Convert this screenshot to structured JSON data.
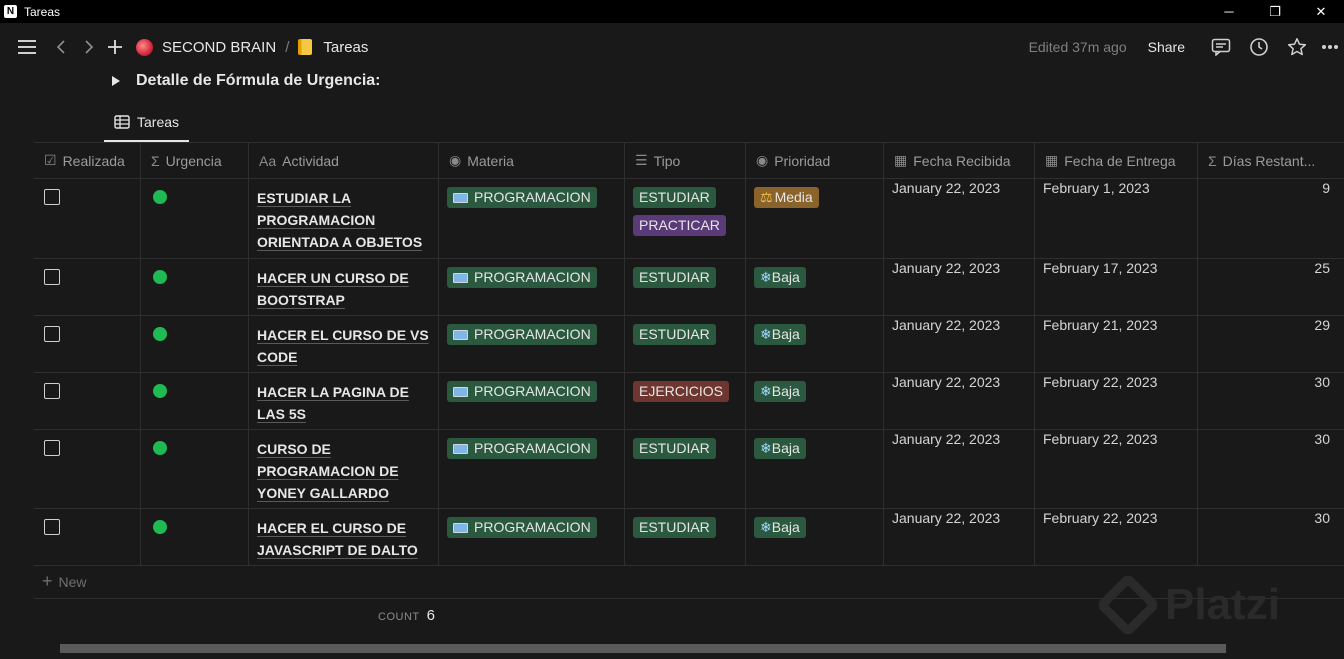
{
  "window": {
    "title": "Tareas",
    "app_icon": "N"
  },
  "breadcrumb": {
    "workspace": "SECOND BRAIN",
    "separator": "/",
    "page": "Tareas"
  },
  "header": {
    "edited": "Edited 37m ago",
    "share": "Share"
  },
  "toggle": {
    "label": "Detalle de Fórmula de Urgencia:"
  },
  "view_tab": {
    "label": "Tareas"
  },
  "columns": [
    {
      "icon": "☑",
      "label": "Realizada"
    },
    {
      "icon": "Σ",
      "label": "Urgencia"
    },
    {
      "icon": "Aa",
      "label": "Actividad"
    },
    {
      "icon": "◉",
      "label": "Materia"
    },
    {
      "icon": "☰",
      "label": "Tipo"
    },
    {
      "icon": "◉",
      "label": "Prioridad"
    },
    {
      "icon": "▦",
      "label": "Fecha Recibida"
    },
    {
      "icon": "▦",
      "label": "Fecha de Entrega"
    },
    {
      "icon": "Σ",
      "label": "Días Restant..."
    }
  ],
  "rows": [
    {
      "activity": "ESTUDIAR LA PROGRAMACION ORIENTADA A OBJETOS",
      "materia": "PROGRAMACION",
      "tipo": [
        "ESTUDIAR",
        "PRACTICAR"
      ],
      "prioridad": "Media",
      "recibida": "January 22, 2023",
      "entrega": "February 1, 2023",
      "dias": "9"
    },
    {
      "activity": "HACER UN CURSO DE BOOTSTRAP",
      "materia": "PROGRAMACION",
      "tipo": [
        "ESTUDIAR"
      ],
      "prioridad": "Baja",
      "recibida": "January 22, 2023",
      "entrega": "February 17, 2023",
      "dias": "25"
    },
    {
      "activity": "HACER EL CURSO DE VS CODE",
      "materia": "PROGRAMACION",
      "tipo": [
        "ESTUDIAR"
      ],
      "prioridad": "Baja",
      "recibida": "January 22, 2023",
      "entrega": "February 21, 2023",
      "dias": "29"
    },
    {
      "activity": "HACER LA PAGINA DE LAS 5S",
      "materia": "PROGRAMACION",
      "tipo": [
        "EJERCICIOS"
      ],
      "prioridad": "Baja",
      "recibida": "January 22, 2023",
      "entrega": "February 22, 2023",
      "dias": "30"
    },
    {
      "activity": "CURSO DE PROGRAMACION DE YONEY GALLARDO",
      "materia": "PROGRAMACION",
      "tipo": [
        "ESTUDIAR"
      ],
      "prioridad": "Baja",
      "recibida": "January 22, 2023",
      "entrega": "February 22, 2023",
      "dias": "30"
    },
    {
      "activity": "HACER EL CURSO DE JAVASCRIPT DE DALTO",
      "materia": "PROGRAMACION",
      "tipo": [
        "ESTUDIAR"
      ],
      "prioridad": "Baja",
      "recibida": "January 22, 2023",
      "entrega": "February 22, 2023",
      "dias": "30"
    }
  ],
  "new_row": {
    "label": "New"
  },
  "footer": {
    "count_label": "COUNT",
    "count_value": "6"
  },
  "watermark": {
    "text": "Platzi"
  },
  "colors": {
    "green_tag": "#2b593f",
    "purple_tag": "#5a3a78",
    "red_tag": "#6e3630",
    "orange_tag": "#89632a",
    "urgency_dot": "#1fba54"
  }
}
